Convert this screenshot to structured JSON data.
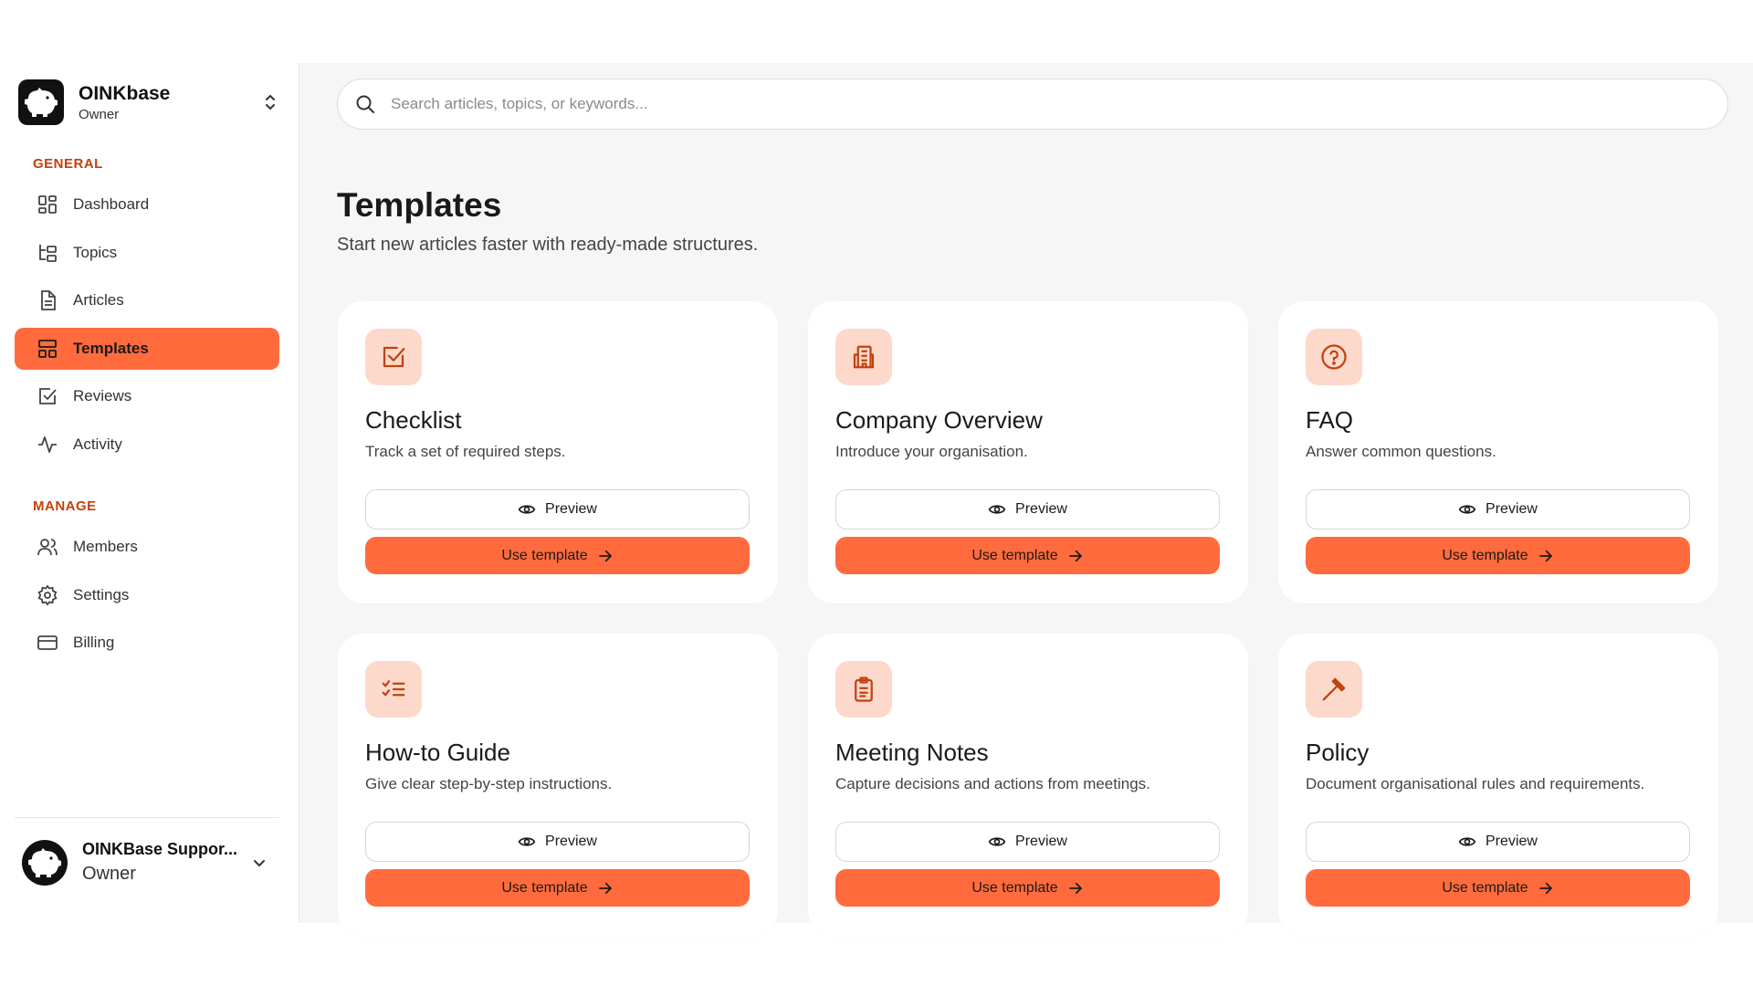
{
  "workspace": {
    "name": "OINKbase",
    "role": "Owner",
    "logo_icon": "pig-logo-icon",
    "switch_icon": "chevron-up-down-icon"
  },
  "sidebar": {
    "general_label": "GENERAL",
    "manage_label": "MANAGE",
    "general_items": [
      {
        "label": "Dashboard",
        "icon": "dashboard-icon",
        "active": false
      },
      {
        "label": "Topics",
        "icon": "topics-icon",
        "active": false
      },
      {
        "label": "Articles",
        "icon": "document-icon",
        "active": false
      },
      {
        "label": "Templates",
        "icon": "templates-icon",
        "active": true
      },
      {
        "label": "Reviews",
        "icon": "checkbox-icon",
        "active": false
      },
      {
        "label": "Activity",
        "icon": "activity-icon",
        "active": false
      }
    ],
    "manage_items": [
      {
        "label": "Members",
        "icon": "users-icon"
      },
      {
        "label": "Settings",
        "icon": "gear-icon"
      },
      {
        "label": "Billing",
        "icon": "credit-card-icon"
      }
    ]
  },
  "user": {
    "name": "OINKBase Suppor...",
    "role": "Owner",
    "avatar_icon": "pig-avatar-icon"
  },
  "search": {
    "placeholder": "Search articles, topics, or keywords..."
  },
  "page": {
    "title": "Templates",
    "subtitle": "Start new articles faster with ready-made structures."
  },
  "buttons": {
    "preview": "Preview",
    "use": "Use template"
  },
  "templates": [
    {
      "title": "Checklist",
      "description": "Track a set of required steps.",
      "icon": "checkbox-icon"
    },
    {
      "title": "Company Overview",
      "description": "Introduce your organisation.",
      "icon": "building-icon"
    },
    {
      "title": "FAQ",
      "description": "Answer common questions.",
      "icon": "question-circle-icon"
    },
    {
      "title": "How-to Guide",
      "description": "Give clear step-by-step instructions.",
      "icon": "list-checks-icon"
    },
    {
      "title": "Meeting Notes",
      "description": "Capture decisions and actions from meetings.",
      "icon": "clipboard-icon"
    },
    {
      "title": "Policy",
      "description": "Document organisational rules and requirements.",
      "icon": "gavel-icon"
    }
  ],
  "colors": {
    "accent": "#ff6b3d",
    "accent_soft": "#fdd9cc",
    "section_label": "#c2410c",
    "icon_stroke": "#c2410c"
  }
}
